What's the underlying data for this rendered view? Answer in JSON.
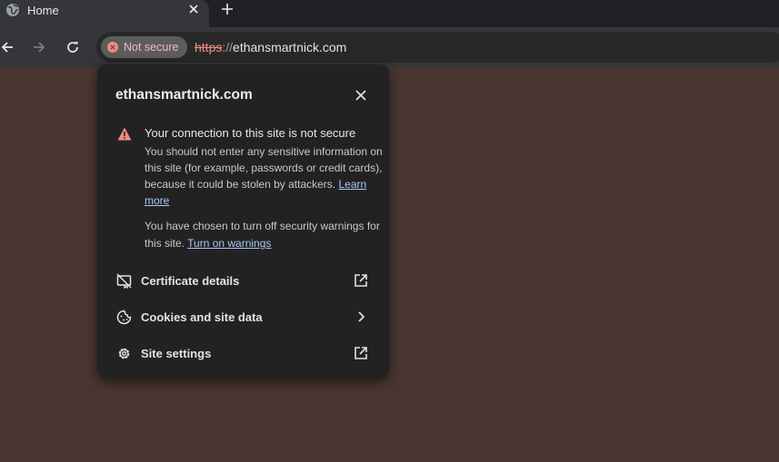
{
  "tab": {
    "title": "Home"
  },
  "toolbar": {
    "chip_label": "Not secure",
    "url_scheme": "https",
    "url_sep": "://",
    "url_host": "ethansmartnick.com"
  },
  "popup": {
    "host": "ethansmartnick.com",
    "warning_title": "Your connection to this site is not secure",
    "warning_body": "You should not enter any sensitive information on this site (for example, passwords or credit cards), because it could be stolen by attackers.",
    "learn_more": "Learn more",
    "warnings_text": "You have chosen to turn off security warnings for this site.",
    "turn_on_warnings": "Turn on warnings",
    "rows": [
      {
        "label": "Certificate details"
      },
      {
        "label": "Cookies and site data"
      },
      {
        "label": "Site settings"
      }
    ]
  },
  "colors": {
    "page_background": "#4a3631",
    "popup_background": "#222222",
    "warning_red": "#f28b82",
    "link_blue": "#a8c7fa"
  }
}
